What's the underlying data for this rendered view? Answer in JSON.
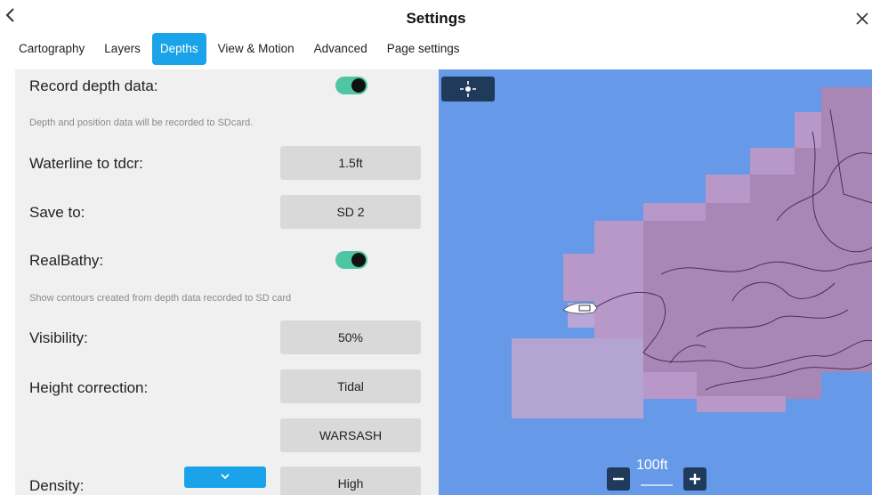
{
  "header": {
    "title": "Settings"
  },
  "tabs": [
    {
      "label": "Cartography"
    },
    {
      "label": "Layers"
    },
    {
      "label": "Depths"
    },
    {
      "label": "View & Motion"
    },
    {
      "label": "Advanced"
    },
    {
      "label": "Page settings"
    }
  ],
  "active_tab": "Depths",
  "settings": {
    "record_depth": {
      "label": "Record depth data:",
      "enabled": true,
      "hint": "Depth and position data will be recorded to SDcard."
    },
    "waterline": {
      "label": "Waterline to tdcr:",
      "value": "1.5ft"
    },
    "save_to": {
      "label": "Save to:",
      "value": "SD 2"
    },
    "realbathy": {
      "label": "RealBathy:",
      "enabled": true,
      "hint": "Show contours created from depth data recorded to SD card"
    },
    "visibility": {
      "label": "Visibility:",
      "value": "50%"
    },
    "height_correction": {
      "label": "Height correction:",
      "value": "Tidal",
      "station": "WARSASH"
    },
    "density": {
      "label": "Density:",
      "value": "High"
    }
  },
  "map": {
    "scale": "100ft"
  },
  "colors": {
    "accent": "#1aa3e8",
    "toggle_on": "#4ec6a4",
    "water": "#6699e8",
    "bathy": "#b49ac4",
    "map_control": "#1f3a5a"
  }
}
